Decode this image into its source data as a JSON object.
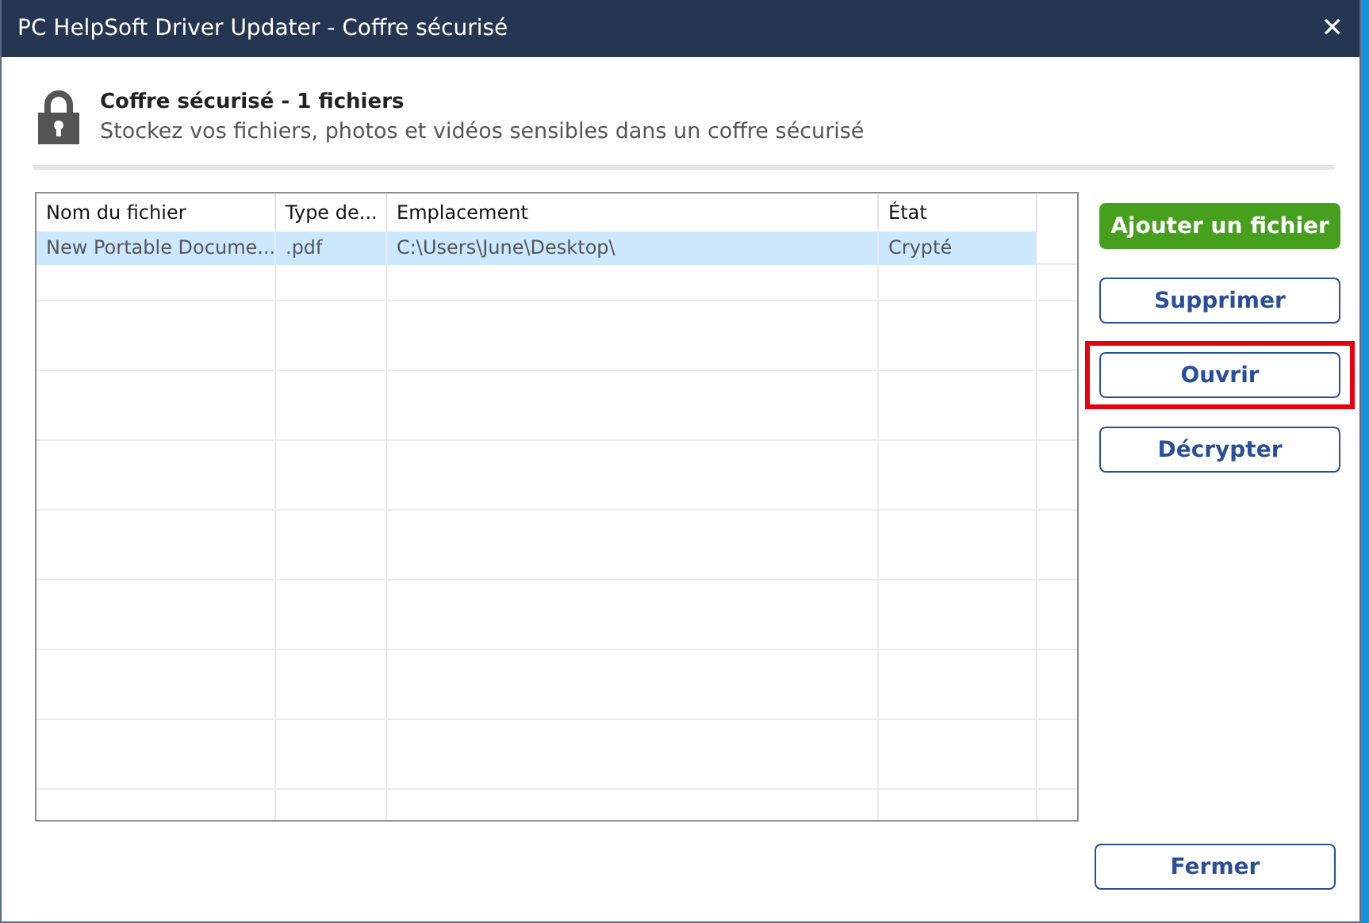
{
  "window": {
    "title": "PC HelpSoft Driver Updater - Coffre sécurisé",
    "close": "✕"
  },
  "header": {
    "title": "Coffre sécurisé - 1 fichiers",
    "subtitle": "Stockez vos fichiers, photos et vidéos sensibles dans un coffre sécurisé"
  },
  "table": {
    "columns": [
      "Nom du fichier",
      "Type de...",
      "Emplacement",
      "État"
    ],
    "rows": [
      {
        "cells": [
          "New Portable Docume...",
          ".pdf",
          "C:\\Users\\June\\Desktop\\",
          "Crypté"
        ],
        "selected": true
      }
    ]
  },
  "buttons": [
    {
      "label": "Ajouter un fichier",
      "kind": "primary",
      "highlighted": false
    },
    {
      "label": "Supprimer",
      "kind": "outline",
      "highlighted": false
    },
    {
      "label": "Ouvrir",
      "kind": "outline",
      "highlighted": true
    },
    {
      "label": "Décrypter",
      "kind": "outline",
      "highlighted": false
    }
  ],
  "footer_button": {
    "label": "Fermer"
  }
}
